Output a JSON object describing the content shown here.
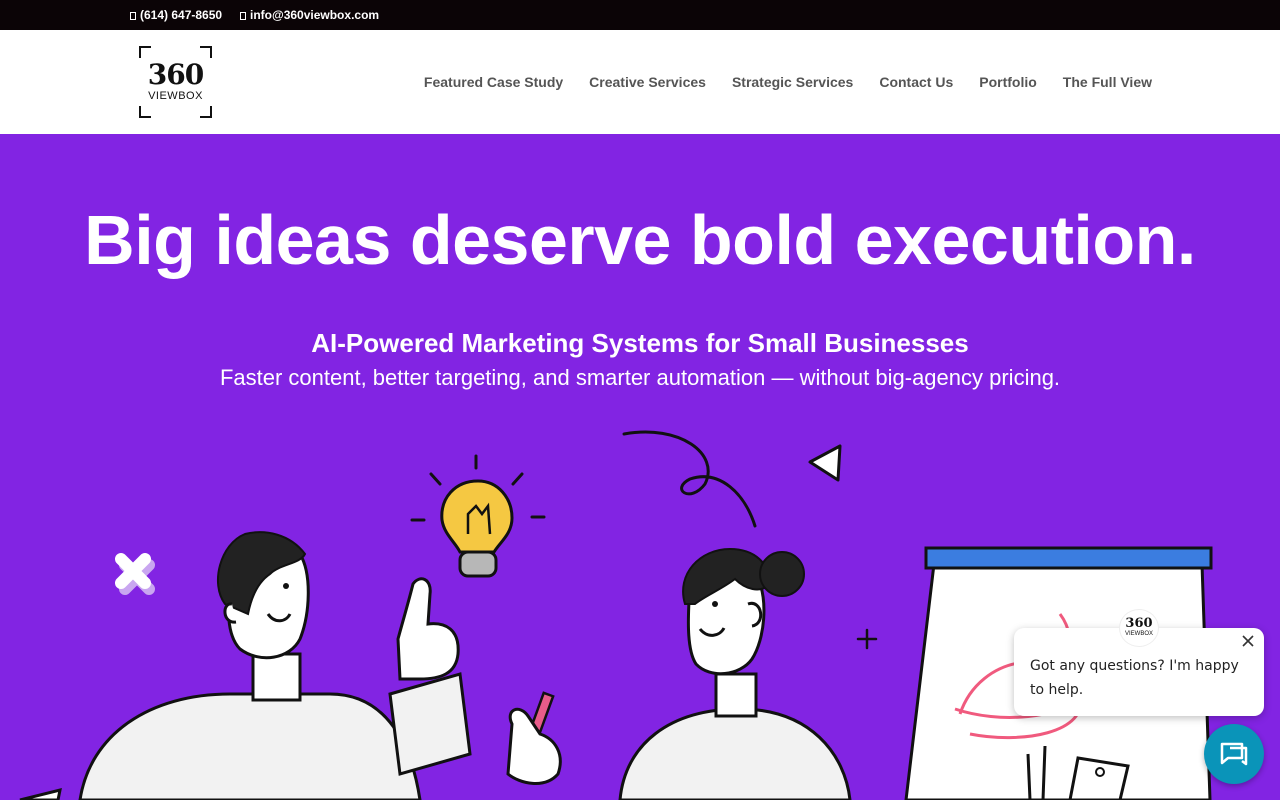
{
  "topbar": {
    "phone": "(614) 647-8650",
    "email": "info@360viewbox.com"
  },
  "logo": {
    "number": "360",
    "word": "VIEWBOX"
  },
  "nav": {
    "items": [
      {
        "label": "Featured Case Study"
      },
      {
        "label": "Creative Services"
      },
      {
        "label": "Strategic Services"
      },
      {
        "label": "Contact Us"
      },
      {
        "label": "Portfolio"
      },
      {
        "label": "The Full View"
      }
    ]
  },
  "hero": {
    "headline": "Big ideas deserve bold execution.",
    "subhead": "AI-Powered Marketing Systems for Small Businesses",
    "subline": "Faster content, better targeting, and smarter automation — without big-agency pricing."
  },
  "chat": {
    "message": "Got any questions? I'm happy to help.",
    "close_icon": "close-icon",
    "launcher_icon": "chat-icon",
    "avatar_number": "360",
    "avatar_word": "VIEWBOX"
  },
  "colors": {
    "hero_bg": "#8224e3",
    "topbar_bg": "#0b0406",
    "chat_launcher": "#0a94b9",
    "bulb": "#f5c842",
    "flipchart_frame": "#3b7de0"
  }
}
